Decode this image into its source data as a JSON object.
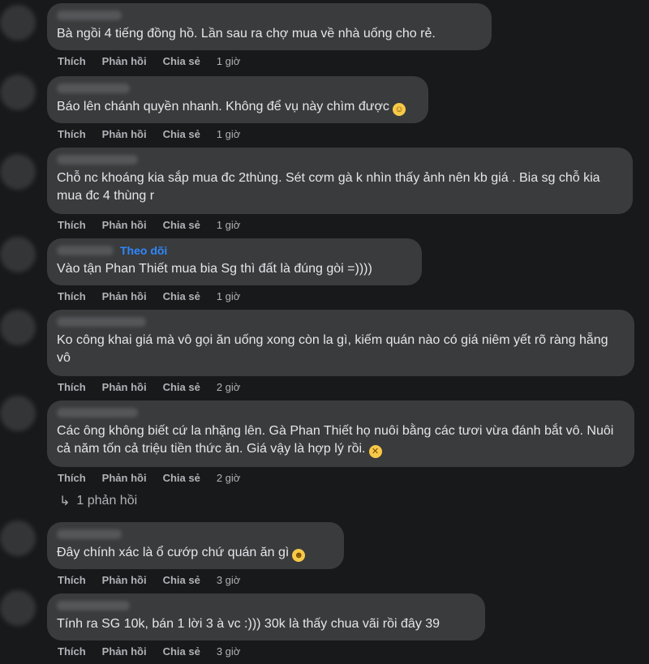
{
  "actions": {
    "like": "Thích",
    "reply": "Phản hồi",
    "share": "Chia sẻ"
  },
  "comments": [
    {
      "text": "Bà ngồi 4 tiếng đồng hồ. Lần sau ra chợ mua về nhà uống cho rẻ.",
      "time": "1 giờ"
    },
    {
      "text": "Báo lên chánh quyền nhanh. Không để vụ này chìm được",
      "time": "1 giờ",
      "emoji": "😂"
    },
    {
      "text": "Chỗ nc khoáng kia sắp mua đc 2thùng. Sét cơm gà k nhìn thấy ảnh nên kb giá . Bia sg chỗ kia mua đc 4 thùng r",
      "time": "1 giờ"
    },
    {
      "text": "Vào tận Phan Thiết mua bia Sg thì đất là đúng gòi =))))",
      "time": "1 giờ",
      "follow": "Theo dõi"
    },
    {
      "text": "Ko công khai giá mà vô gọi ăn uống xong còn la gì, kiếm quán nào có giá niêm yết rõ ràng hẵng vô",
      "time": "2 giờ"
    },
    {
      "text": "Các ông không biết cứ la nhặng lên. Gà Phan Thiết họ nuôi bằng các tươi vừa đánh bắt vô. Nuôi cả năm tốn cả triệu tiền thức ăn. Giá vậy là hợp lý rồi.",
      "time": "2 giờ",
      "emoji": "😵"
    },
    {
      "text": "Đây chính xác là ổ cướp chứ quán ăn gì",
      "time": "3 giờ",
      "emoji": "😆"
    },
    {
      "text": "Tính ra SG 10k, bán 1 lời 3 à vc :))) 30k là thấy chua vãi rồi đây 39",
      "time": "3 giờ"
    }
  ],
  "replies_link": "1 phản hồi"
}
